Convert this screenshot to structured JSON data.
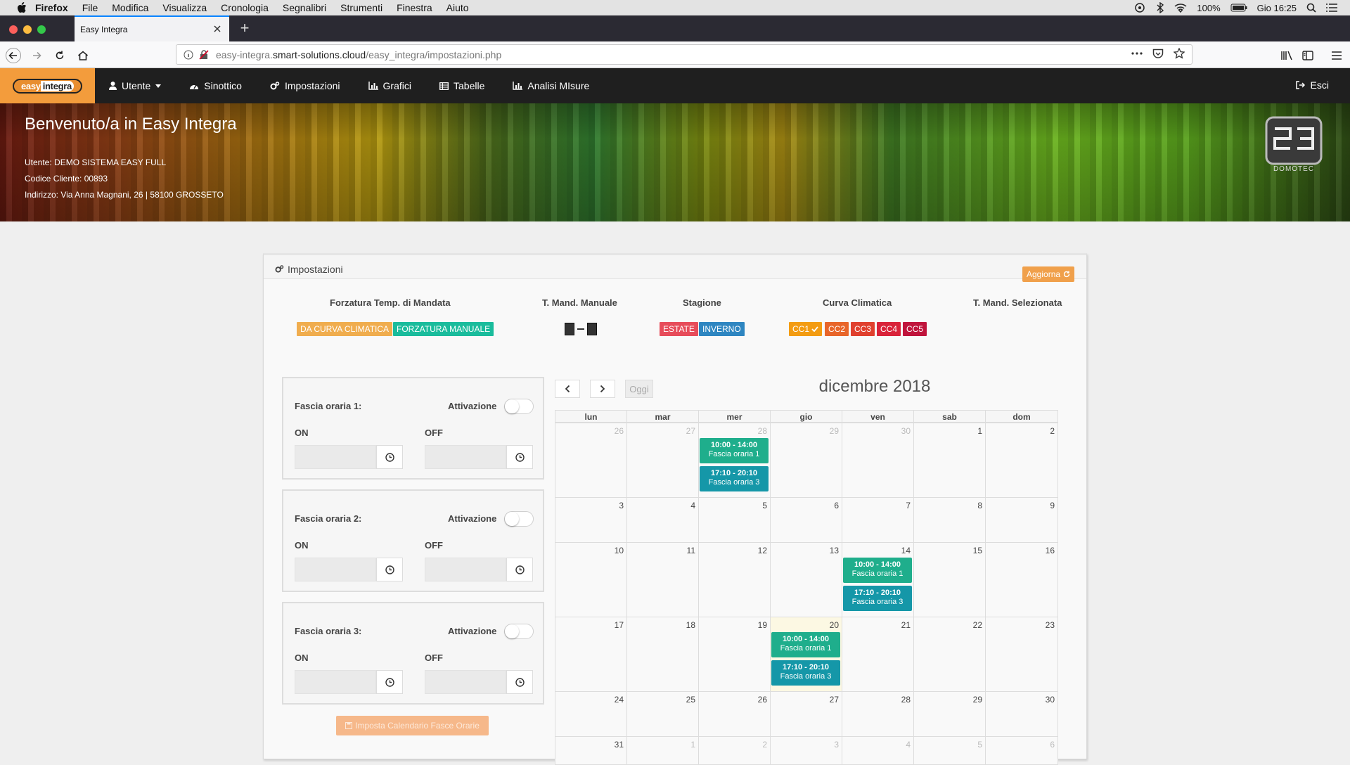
{
  "macbar": {
    "items": [
      "Firefox",
      "File",
      "Modifica",
      "Visualizza",
      "Cronologia",
      "Segnalibri",
      "Strumenti",
      "Finestra",
      "Aiuto"
    ],
    "battery": "100%",
    "clock": "Gio 16:25"
  },
  "browser": {
    "tab_title": "Easy Integra",
    "url_prefix": "easy-integra.",
    "url_domain": "smart-solutions.cloud",
    "url_path": "/easy_integra/impostazioni.php"
  },
  "appnav": {
    "brand_a": "easy",
    "brand_b": "integra",
    "menu": [
      "Utente",
      "Sinottico",
      "Impostazioni",
      "Grafici",
      "Tabelle",
      "Analisi MIsure"
    ],
    "logout": "Esci"
  },
  "banner": {
    "title": "Benvenuto/a in Easy Integra",
    "user": "Utente: DEMO SISTEMA EASY FULL",
    "code": "Codice Cliente: 00893",
    "address": "Indirizzo: Via Anna Magnani, 26 | 58100 GROSSETO",
    "logo_text": "DOMOTEC"
  },
  "panel": {
    "title": "Impostazioni",
    "refresh": "Aggiorna",
    "headers": {
      "forzatura": "Forzatura Temp. di Mandata",
      "manuale": "T. Mand. Manuale",
      "stagione": "Stagione",
      "curva": "Curva Climatica",
      "selezionata": "T. Mand. Selezionata"
    },
    "forzatura_buttons": [
      "DA CURVA CLIMATICA",
      "FORZATURA MANUALE"
    ],
    "stagione_buttons": [
      "ESTATE",
      "INVERNO"
    ],
    "curva_buttons": [
      "CC1",
      "CC2",
      "CC3",
      "CC4",
      "CC5"
    ],
    "colors": {
      "orange": "#f0ad4e",
      "teal": "#1abc9c",
      "red": "#e74c5a",
      "blue": "#2e86c1",
      "darkorange": "#f39c12",
      "orangered": "#e8562a",
      "crimson": "#d9233a",
      "maroon": "#c0143c",
      "event_green": "#1fae8c",
      "event_teal": "#1597a8"
    }
  },
  "fasce": [
    {
      "title": "Fascia oraria 1:",
      "activation": "Attivazione",
      "on": "ON",
      "off": "OFF"
    },
    {
      "title": "Fascia oraria 2:",
      "activation": "Attivazione",
      "on": "ON",
      "off": "OFF"
    },
    {
      "title": "Fascia oraria 3:",
      "activation": "Attivazione",
      "on": "ON",
      "off": "OFF"
    }
  ],
  "imposta_button": "Imposta Calendario Fasce Orarie",
  "calendar": {
    "title": "dicembre 2018",
    "today_label": "Oggi",
    "days": [
      "lun",
      "mar",
      "mer",
      "gio",
      "ven",
      "sab",
      "dom"
    ],
    "weeks": [
      [
        "26",
        "27",
        "28",
        "29",
        "30",
        "1",
        "2"
      ],
      [
        "3",
        "4",
        "5",
        "6",
        "7",
        "8",
        "9"
      ],
      [
        "10",
        "11",
        "12",
        "13",
        "14",
        "15",
        "16"
      ],
      [
        "17",
        "18",
        "19",
        "20",
        "21",
        "22",
        "23"
      ],
      [
        "24",
        "25",
        "26",
        "27",
        "28",
        "29",
        "30"
      ],
      [
        "31",
        "1",
        "2",
        "3",
        "4",
        "5",
        "6"
      ]
    ],
    "events": {
      "e1_time": "10:00 - 14:00",
      "e1_name": "Fascia oraria 1",
      "e3_time": "17:10 - 20:10",
      "e3_name": "Fascia oraria 3"
    }
  }
}
